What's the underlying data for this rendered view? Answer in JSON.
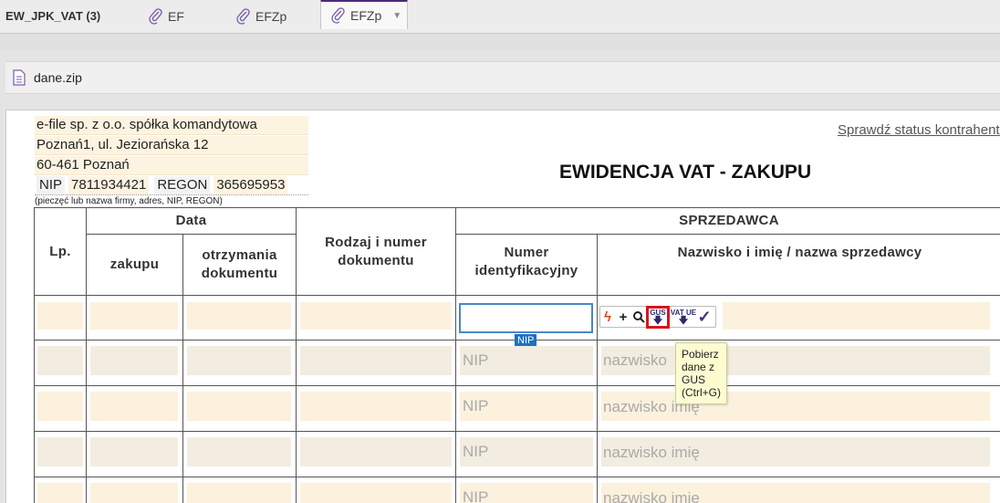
{
  "tabs": {
    "main_label": "EW_JPK_VAT (3)",
    "ef_label": "EF",
    "efzp1_label": "EFZp",
    "active_label": "EFZp"
  },
  "file": {
    "name": "dane.zip"
  },
  "company": {
    "line1": "e-file sp. z o.o. spółka komandytowa",
    "line2": "Poznań1, ul. Jeziorańska 12",
    "line3": "60-461 Poznań",
    "nip_label": "NIP",
    "nip_value": "7811934421",
    "regon_label": "REGON",
    "regon_value": "365695953",
    "stamp_note": "(pieczęć lub nazwa firmy, adres, NIP, REGON)"
  },
  "status_link": "Sprawdź status kontrahenta",
  "title": "EWIDENCJA VAT - ZAKUPU",
  "headers": {
    "lp": "Lp.",
    "data": "Data",
    "zakupu": "zakupu",
    "otrzymania": "otrzymania dokumentu",
    "rodzaj": "Rodzaj i numer dokumentu",
    "sprzedawca": "SPRZEDAWCA",
    "numer": "Numer identyfikacyjny",
    "nazwisko": "Nazwisko i imię / nazwa sprzedawcy"
  },
  "placeholders": {
    "nip": "NIP",
    "name": "nazwisko imię",
    "name_partial": "nazwisko"
  },
  "active_field": {
    "tag": "NIP"
  },
  "toolbar": {
    "plus": "+",
    "gus": "GUS",
    "vatue": "VAT UE"
  },
  "tooltip": "Pobierz dane z GUS (Ctrl+G)"
}
